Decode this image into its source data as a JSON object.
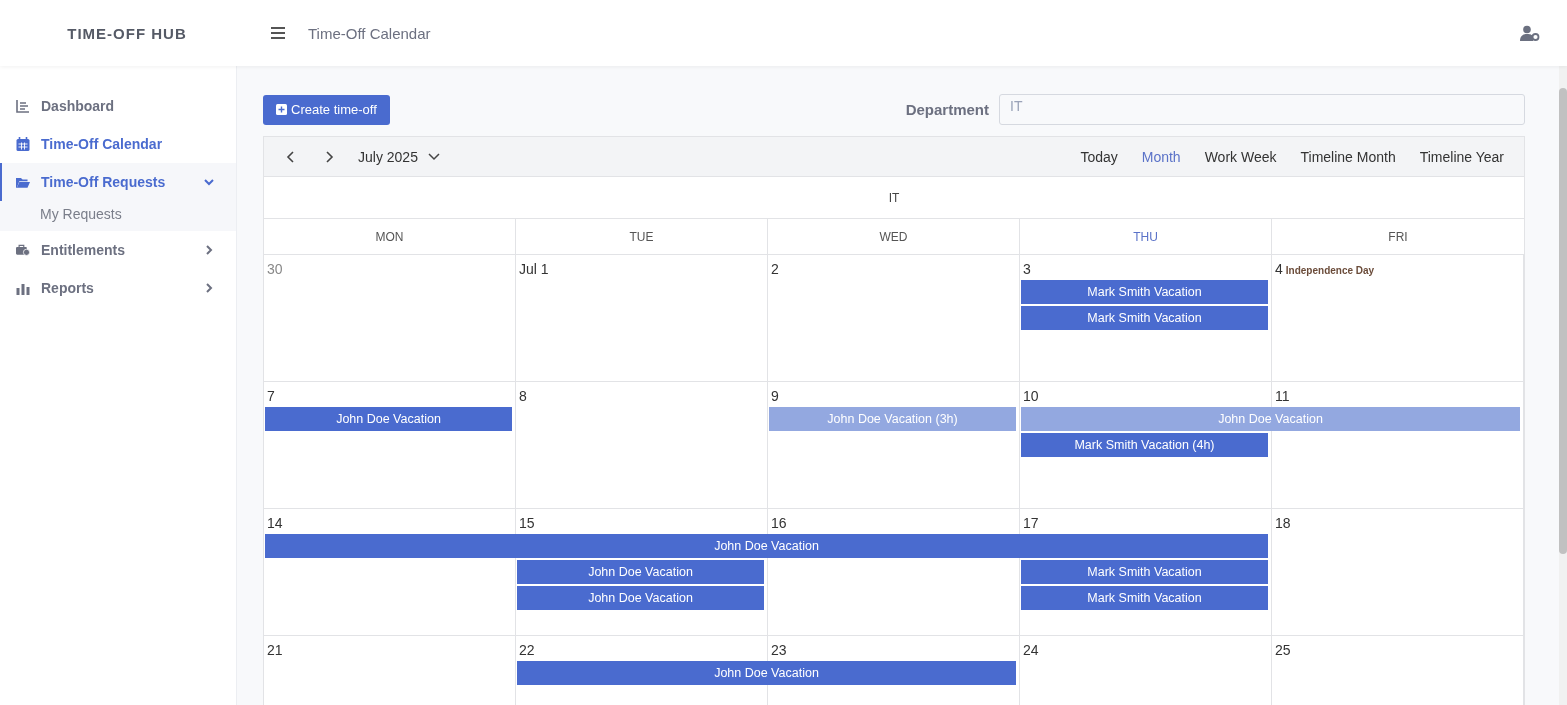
{
  "brand": {
    "light": "TIME-OFF",
    "bold": "HUB"
  },
  "header": {
    "title": "Time-Off Calendar"
  },
  "sidebar": {
    "items": [
      {
        "label": "Dashboard",
        "kind": "link",
        "selected": false
      },
      {
        "label": "Time-Off Calendar",
        "kind": "link",
        "selected": true
      },
      {
        "label": "Time-Off Requests",
        "kind": "group",
        "selected": true,
        "expanded": true,
        "children": [
          {
            "label": "My Requests"
          }
        ]
      },
      {
        "label": "Entitlements",
        "kind": "group",
        "selected": false,
        "expanded": false
      },
      {
        "label": "Reports",
        "kind": "group",
        "selected": false,
        "expanded": false
      }
    ]
  },
  "create_button": "Create time-off",
  "department": {
    "label": "Department",
    "value": "IT"
  },
  "calendar": {
    "period": "July 2025",
    "views": [
      {
        "label": "Today",
        "selected": false
      },
      {
        "label": "Month",
        "selected": true
      },
      {
        "label": "Work Week",
        "selected": false
      },
      {
        "label": "Timeline Month",
        "selected": false
      },
      {
        "label": "Timeline Year",
        "selected": false
      }
    ],
    "group": "IT",
    "weekdays": [
      {
        "label": "MON",
        "highlighted": false
      },
      {
        "label": "TUE",
        "highlighted": false
      },
      {
        "label": "WED",
        "highlighted": false
      },
      {
        "label": "THU",
        "highlighted": true
      },
      {
        "label": "FRI",
        "highlighted": false
      }
    ],
    "weeks": [
      {
        "days": [
          {
            "label": "30",
            "muted": true
          },
          {
            "label": "Jul 1",
            "muted": false
          },
          {
            "label": "2",
            "muted": false
          },
          {
            "label": "3",
            "muted": false
          },
          {
            "label": "4",
            "muted": false,
            "holiday": "Independence Day"
          }
        ],
        "lanes": [
          [
            {
              "kind": "empty"
            },
            {
              "kind": "empty"
            },
            {
              "kind": "empty"
            },
            {
              "kind": "event",
              "title": "Mark Smith Vacation",
              "pending": false
            },
            {
              "kind": "empty"
            }
          ],
          [
            {
              "kind": "empty"
            },
            {
              "kind": "empty"
            },
            {
              "kind": "empty"
            },
            {
              "kind": "event",
              "title": "Mark Smith Vacation",
              "pending": false
            },
            {
              "kind": "empty"
            }
          ]
        ]
      },
      {
        "days": [
          {
            "label": "7",
            "muted": false
          },
          {
            "label": "8",
            "muted": false
          },
          {
            "label": "9",
            "muted": false
          },
          {
            "label": "10",
            "muted": false
          },
          {
            "label": "11",
            "muted": false
          }
        ],
        "lanes": [
          [
            {
              "kind": "event",
              "title": "John Doe Vacation",
              "pending": false
            },
            {
              "kind": "empty"
            },
            {
              "kind": "event",
              "title": "John Doe Vacation (3h)",
              "pending": true
            },
            {
              "kind": "event",
              "title": "John Doe Vacation",
              "pending": true
            },
            {
              "kind": "continued"
            }
          ],
          [
            {
              "kind": "empty"
            },
            {
              "kind": "empty"
            },
            {
              "kind": "empty"
            },
            {
              "kind": "event",
              "title": "Mark Smith Vacation (4h)",
              "pending": false
            },
            {
              "kind": "empty"
            }
          ]
        ]
      },
      {
        "days": [
          {
            "label": "14",
            "muted": false
          },
          {
            "label": "15",
            "muted": false
          },
          {
            "label": "16",
            "muted": false
          },
          {
            "label": "17",
            "muted": false
          },
          {
            "label": "18",
            "muted": false
          }
        ],
        "lanes": [
          [
            {
              "kind": "event",
              "title": "John Doe Vacation",
              "pending": false
            },
            {
              "kind": "continued"
            },
            {
              "kind": "continued"
            },
            {
              "kind": "continued"
            },
            {
              "kind": "empty"
            }
          ],
          [
            {
              "kind": "empty"
            },
            {
              "kind": "event",
              "title": "John Doe Vacation",
              "pending": false
            },
            {
              "kind": "empty"
            },
            {
              "kind": "event",
              "title": "Mark Smith Vacation",
              "pending": false
            },
            {
              "kind": "empty"
            }
          ],
          [
            {
              "kind": "empty"
            },
            {
              "kind": "event",
              "title": "John Doe Vacation",
              "pending": false
            },
            {
              "kind": "empty"
            },
            {
              "kind": "event",
              "title": "Mark Smith Vacation",
              "pending": false
            },
            {
              "kind": "empty"
            }
          ]
        ]
      },
      {
        "days": [
          {
            "label": "21",
            "muted": false
          },
          {
            "label": "22",
            "muted": false
          },
          {
            "label": "23",
            "muted": false
          },
          {
            "label": "24",
            "muted": false
          },
          {
            "label": "25",
            "muted": false
          }
        ],
        "lanes": [
          [
            {
              "kind": "empty"
            },
            {
              "kind": "event",
              "title": "John Doe Vacation",
              "pending": false
            },
            {
              "kind": "continued"
            },
            {
              "kind": "empty"
            },
            {
              "kind": "empty"
            }
          ]
        ]
      }
    ]
  }
}
